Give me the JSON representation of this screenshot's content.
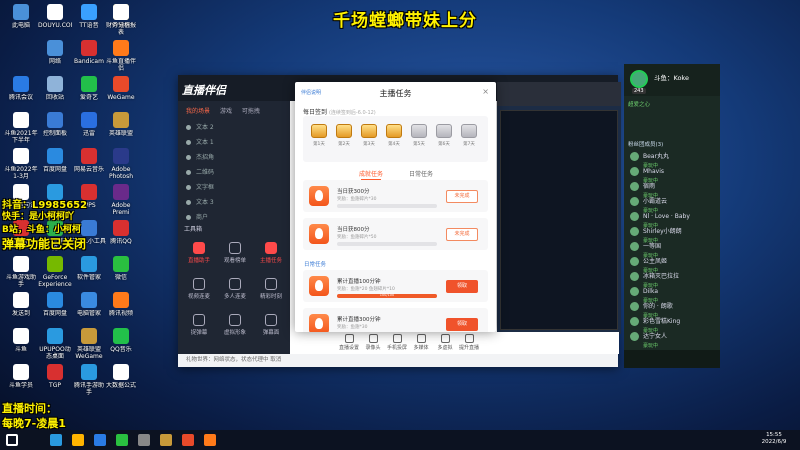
{
  "stream_title": "千场螳螂带妹上分",
  "overlay": {
    "douyin": "抖音：L9985652",
    "kuaishou": "快手：是小柯柯吖",
    "bilibili": "B站，斗鱼：小柯柯",
    "barrage": "弹幕功能已关闭",
    "live_time_label": "直播时间：",
    "live_time_value": "每晚7-凌晨1"
  },
  "desktop_icons": [
    {
      "label": "此电脑",
      "color": "#4a90d9"
    },
    {
      "label": "DOUYU.COM",
      "color": "#ffffff"
    },
    {
      "label": "TT语音",
      "color": "#3aa0ff"
    },
    {
      "label": "YY语音",
      "color": "#f5c400"
    },
    {
      "label": "财务分析报表",
      "color": "#ffffff"
    },
    {
      "label": "网络",
      "color": "#4a90d9"
    },
    {
      "label": "Bandicam",
      "color": "#d83030"
    },
    {
      "label": "斗鱼直播伴侣",
      "color": "#ff7a1a"
    },
    {
      "label": "腾讯会议",
      "color": "#2a7be4"
    },
    {
      "label": "回收站",
      "color": "#8fb3d9"
    },
    {
      "label": "爱奇艺",
      "color": "#22c04a"
    },
    {
      "label": "WeGame",
      "color": "#e84a2a"
    },
    {
      "label": "斗鱼2021年下半年",
      "color": "#ffffff"
    },
    {
      "label": "控制面板",
      "color": "#3a7bd5"
    },
    {
      "label": "迅雷",
      "color": "#2a6fe0"
    },
    {
      "label": "英雄联盟",
      "color": "#c89a3a"
    },
    {
      "label": "斗鱼2022年1-3月",
      "color": "#ffffff"
    },
    {
      "label": "百度网盘",
      "color": "#2a8ae0"
    },
    {
      "label": "网易云音乐",
      "color": "#d83030"
    },
    {
      "label": "Adobe Photosh",
      "color": "#2a3a8a"
    },
    {
      "label": "黄伊者句话",
      "color": "#ffffff"
    },
    {
      "label": "QQ",
      "color": "#2a9ae0"
    },
    {
      "label": "WPS",
      "color": "#d83030"
    },
    {
      "label": "Adobe Premi",
      "color": "#6a2a8a"
    },
    {
      "label": "金字塔",
      "color": "#d83030"
    },
    {
      "label": "360极速浏览",
      "color": "#2ab04a"
    },
    {
      "label": "ROFL小工具",
      "color": "#3a7bd5"
    },
    {
      "label": "腾讯QQ",
      "color": "#d83030"
    },
    {
      "label": "斗鱼游戏助手",
      "color": "#ffffff"
    },
    {
      "label": "GeForce Experience",
      "color": "#76b900"
    },
    {
      "label": "软件管家",
      "color": "#2a9ae0"
    },
    {
      "label": "微信",
      "color": "#2ac040"
    },
    {
      "label": "发送到",
      "color": "#ffffff"
    },
    {
      "label": "百度网盘",
      "color": "#2a8ae0"
    },
    {
      "label": "电脑管家",
      "color": "#3a8ae0"
    },
    {
      "label": "腾讯视频",
      "color": "#ff7a1a"
    },
    {
      "label": "斗鱼",
      "color": "#ffffff"
    },
    {
      "label": "UPUPOO动态桌面",
      "color": "#2a9ae0"
    },
    {
      "label": "英雄联盟WeGame",
      "color": "#c89a3a"
    },
    {
      "label": "QQ音乐",
      "color": "#22c04a"
    },
    {
      "label": "斗鱼学员",
      "color": "#ffffff"
    },
    {
      "label": "TGP",
      "color": "#d83030"
    },
    {
      "label": "腾讯手游助手",
      "color": "#2a9ae0"
    },
    {
      "label": "大数据公式",
      "color": "#ffffff"
    }
  ],
  "app": {
    "logo": "直播伴侣",
    "left_tabs": [
      "我的场景",
      "游戏",
      "可拖拽"
    ],
    "scenes": [
      "文本 2",
      "文本 1",
      "杰招角",
      "二维码",
      "文字框",
      "文本 3",
      "商户"
    ],
    "tools_header": "工具箱",
    "tools": [
      {
        "label": "直播助手",
        "active": true
      },
      {
        "label": "观看榜单",
        "active": false
      },
      {
        "label": "主播任务",
        "active": true
      },
      {
        "label": "视频连麦",
        "active": false
      },
      {
        "label": "多人连麦",
        "active": false
      },
      {
        "label": "精彩时刻",
        "active": false
      },
      {
        "label": "捉弹幕",
        "active": false
      },
      {
        "label": "虚拟形象",
        "active": false
      },
      {
        "label": "弹幕面",
        "active": false
      }
    ],
    "footer": "礼物世界：网络状态，状态代理中  取消",
    "bottom_tools": [
      "直播设置",
      "录像头",
      "手机投屏",
      "多媒体",
      "多虚拟",
      "提升直播"
    ]
  },
  "modal": {
    "tag": "伴侣说明",
    "title": "主播任务",
    "close": "×",
    "signin_label": "每日签到",
    "signin_note": "(连续签到后-6.0-12)",
    "days": [
      {
        "label": "第1天",
        "claimed": true
      },
      {
        "label": "第2天",
        "claimed": true
      },
      {
        "label": "第3天",
        "claimed": true
      },
      {
        "label": "第4天",
        "claimed": true
      },
      {
        "label": "第5天",
        "claimed": false
      },
      {
        "label": "第6天",
        "claimed": false
      },
      {
        "label": "第7天",
        "claimed": false
      }
    ],
    "tabs": {
      "active": "成就任务",
      "inactive": "日常任务"
    },
    "tasks": [
      {
        "name": "当日获300分",
        "reward": "奖励：鱼翅碎片*30",
        "button": "未完成",
        "progress": 0.0,
        "progress_text": "",
        "style": "outline"
      },
      {
        "name": "当日获800分",
        "reward": "奖励：鱼翅碎片*50",
        "button": "未完成",
        "progress": 0.0,
        "progress_text": "",
        "style": "outline"
      }
    ],
    "section_label": "日常任务",
    "daily_tasks": [
      {
        "name": "累计直播100分钟",
        "reward": "奖励：鱼翅*20 鱼翅碎片*10",
        "button": "领取",
        "progress": 1.0,
        "progress_text": "100/100",
        "style": "fill"
      },
      {
        "name": "累计直播300分钟",
        "reward": "奖励：鱼翅*30",
        "button": "领取",
        "progress": 1.0,
        "progress_text": "",
        "style": "fill"
      }
    ]
  },
  "chat": {
    "streamer": "斗鱼：Koke",
    "level": "243",
    "section": "粉丝团成员(3)",
    "sub": "超爱之心",
    "users": [
      "Bear丸丸",
      "Mhavis",
      "宿雨",
      "小霸道云",
      "Nl · Love · Baby",
      "Shirley小朗朗",
      "一等国",
      "公主凤姬",
      "冰箱灭巴拉拉",
      "Dilka",
      "你的 · 朗歌",
      "彩色雪糕King",
      "达宁女人"
    ],
    "user_sub": "豪玩中"
  },
  "clock": {
    "time": "15:55",
    "date": "2022/6/9"
  },
  "colors": {
    "accent": "#ff5a2c",
    "chest_gold": "#e49a25",
    "chat_green": "#6ed06e",
    "title_yellow": "#fff200"
  }
}
